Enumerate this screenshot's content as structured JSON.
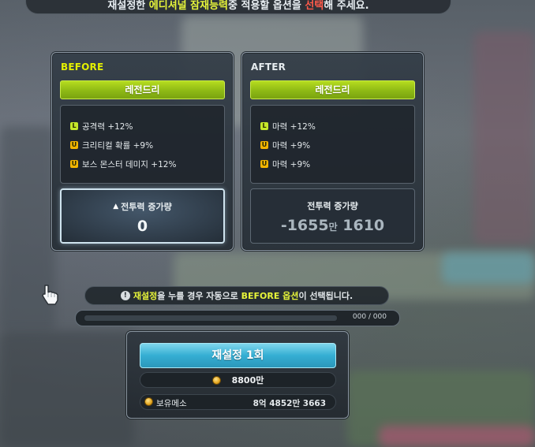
{
  "top_notice": {
    "part1": "재설정한 ",
    "part2": "에디셔널 잠재능력",
    "part3": "중 적용할 옵션을 ",
    "part4": "선택",
    "part5": "해 주세요."
  },
  "before": {
    "title": "BEFORE",
    "grade": "레전드리",
    "options": [
      {
        "grade": "L",
        "text": "공격력 +12%"
      },
      {
        "grade": "U",
        "text": "크리티컬 확률 +9%"
      },
      {
        "grade": "U",
        "text": "보스 몬스터 데미지 +12%"
      }
    ],
    "power_label": "전투력 증가량",
    "power_value": "0"
  },
  "after": {
    "title": "AFTER",
    "grade": "레전드리",
    "options": [
      {
        "grade": "L",
        "text": "마력 +12%"
      },
      {
        "grade": "U",
        "text": "마력 +9%"
      },
      {
        "grade": "U",
        "text": "마력 +9%"
      }
    ],
    "power_label": "전투력 증가량",
    "power_value_main": "-1655",
    "power_value_unit": "만",
    "power_value_rest": " 1610"
  },
  "warning": {
    "a": "재설정",
    "b": "을 누를 경우 자동으로 ",
    "c": "BEFORE 옵션",
    "d": "이 선택됩니다."
  },
  "progress": {
    "text": "000 / 000",
    "fraction": 0
  },
  "reset": {
    "button_label": "재설정 1회",
    "cost": "8800만",
    "meso_label": "보유메소",
    "meso_value": "8억 4852만 3663"
  },
  "colors": {
    "grade_legendary": "#9cc418",
    "button_blue": "#35aed3",
    "highlight_yellow": "#e7f53a",
    "highlight_red": "#ff5a4a"
  }
}
